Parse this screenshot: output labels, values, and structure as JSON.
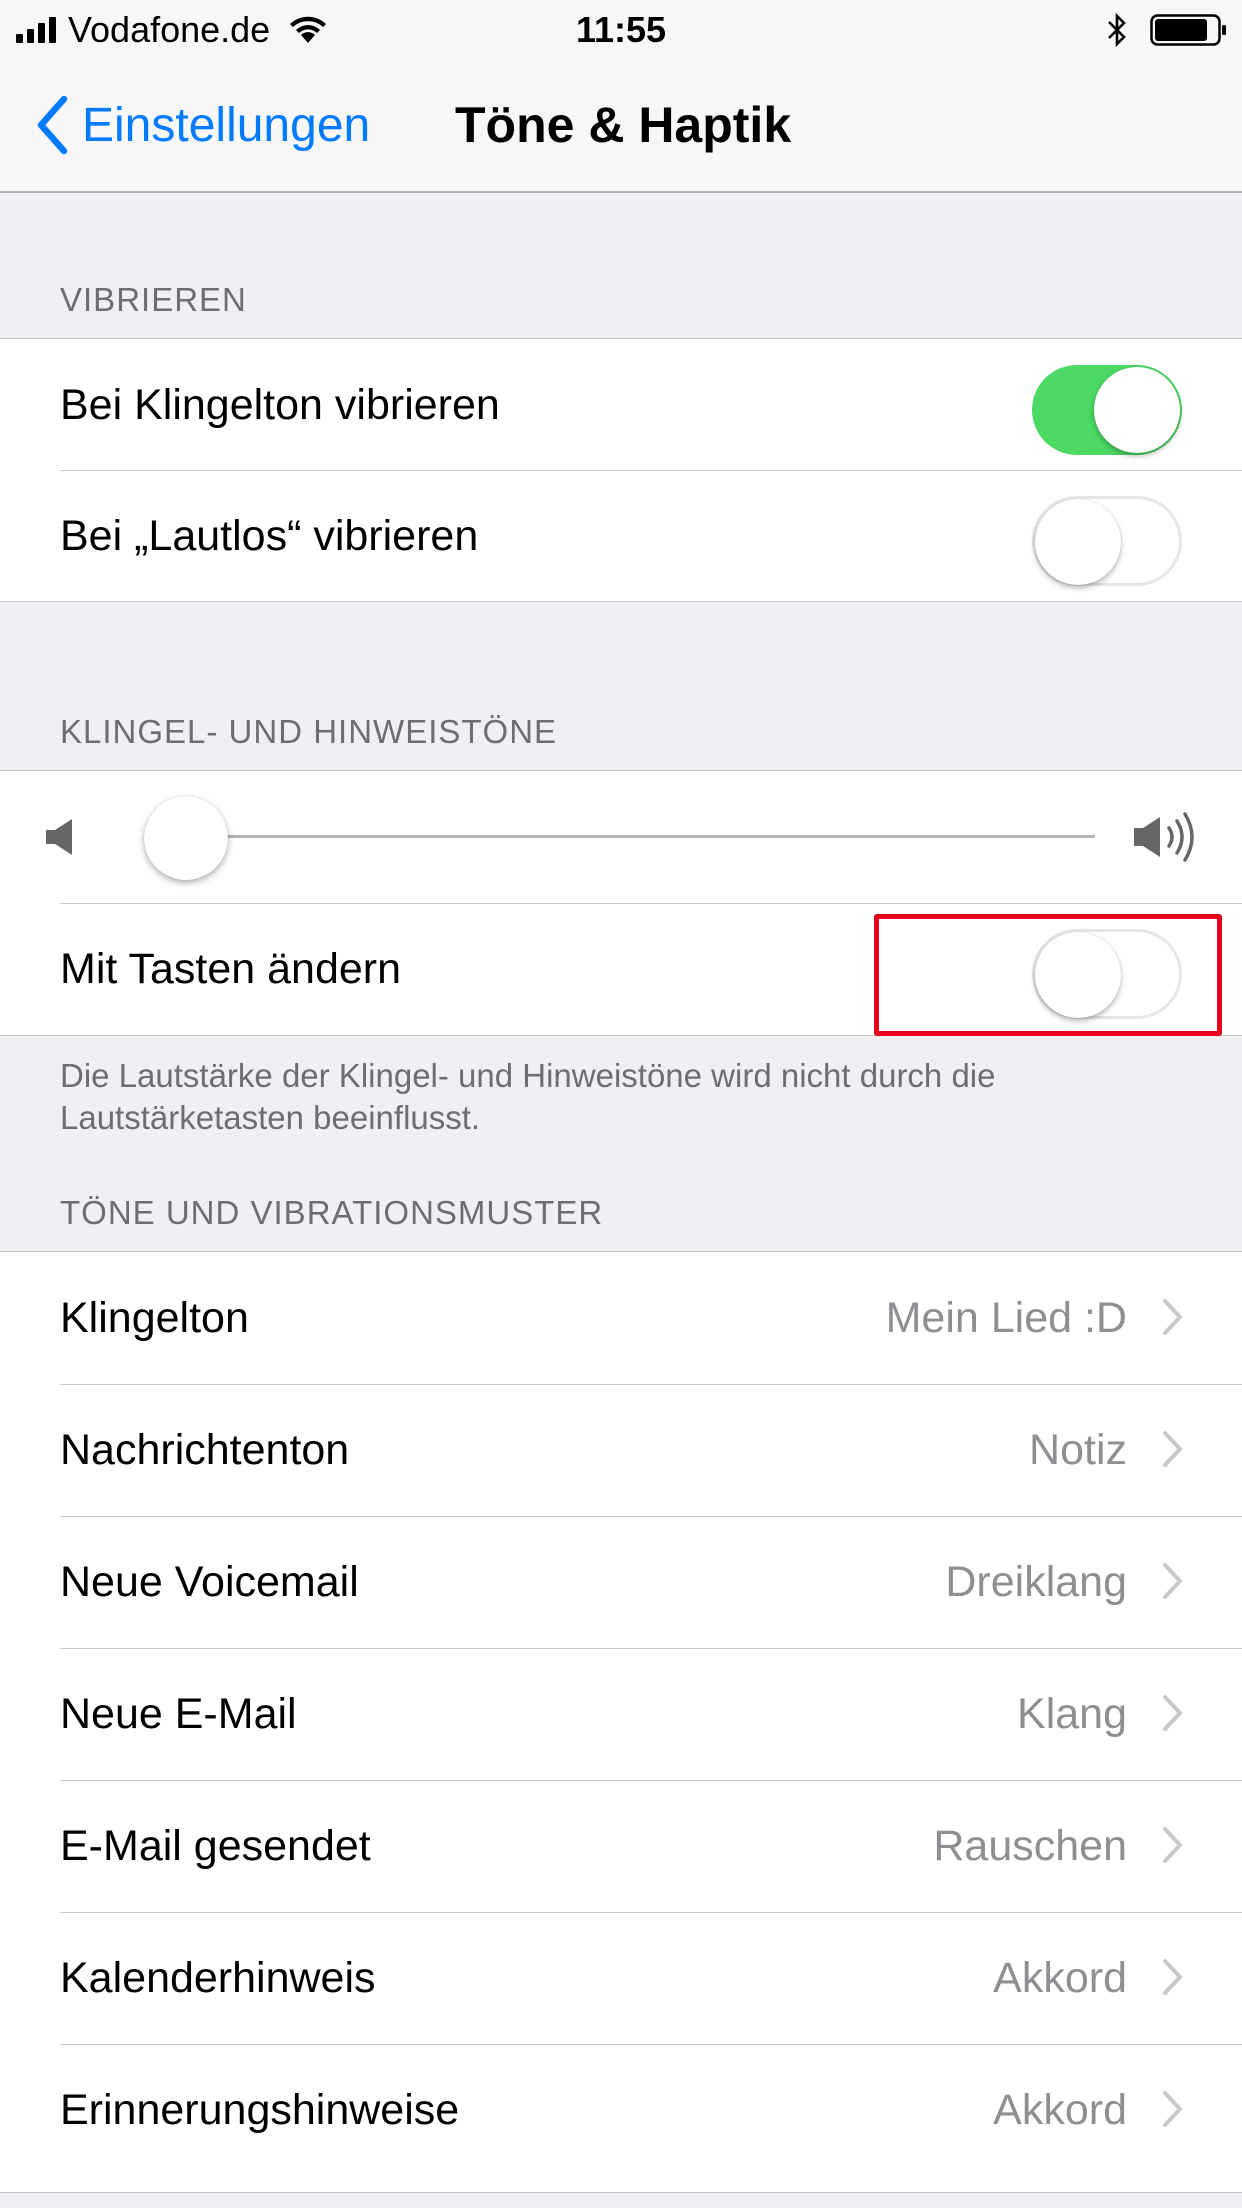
{
  "status_bar": {
    "carrier": "Vodafone.de",
    "time": "11:55"
  },
  "nav": {
    "back_label": "Einstellungen",
    "title": "Töne & Haptik"
  },
  "vibrate": {
    "header": "VIBRIEREN",
    "ring_label": "Bei Klingelton vibrieren",
    "ring_on": true,
    "silent_label": "Bei „Lautlos“ vibrieren",
    "silent_on": false
  },
  "ringer": {
    "header": "KLINGEL- UND HINWEISTÖNE",
    "volume_level": 0.0,
    "buttons_label": "Mit Tasten ändern",
    "buttons_on": false,
    "footer": "Die Lautstärke der Klingel- und Hinweistöne wird nicht durch die Lautstärketasten beeinflusst."
  },
  "sounds": {
    "header": "TÖNE UND VIBRATIONSMUSTER",
    "items": [
      {
        "label": "Klingelton",
        "value": "Mein Lied :D"
      },
      {
        "label": "Nachrichtenton",
        "value": "Notiz"
      },
      {
        "label": "Neue Voicemail",
        "value": "Dreiklang"
      },
      {
        "label": "Neue E-Mail",
        "value": "Klang"
      },
      {
        "label": "E-Mail gesendet",
        "value": "Rauschen"
      },
      {
        "label": "Kalenderhinweis",
        "value": "Akkord"
      },
      {
        "label": "Erinnerungshinweise",
        "value": "Akkord"
      }
    ]
  },
  "colors": {
    "accent": "#007aff",
    "toggle_on": "#4cd964",
    "highlight": "#e8001c"
  }
}
